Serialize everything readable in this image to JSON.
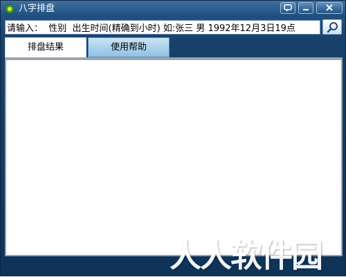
{
  "window": {
    "title": "八字排盘",
    "accent": "#17406a"
  },
  "titlebar_buttons": {
    "chat_icon": "chat-bubble-icon",
    "minimize_icon": "minimize-icon",
    "close_icon": "close-icon"
  },
  "input": {
    "value": "请输入：  性别  出生时间(精确到小时) 如:张三 男 1992年12月3日19点",
    "placeholder": ""
  },
  "search_button": {
    "icon": "search-icon"
  },
  "tabs": [
    {
      "label": "排盘结果",
      "active": true
    },
    {
      "label": "使用帮助",
      "active": false
    }
  ],
  "watermark": {
    "text": "人人软件园"
  }
}
